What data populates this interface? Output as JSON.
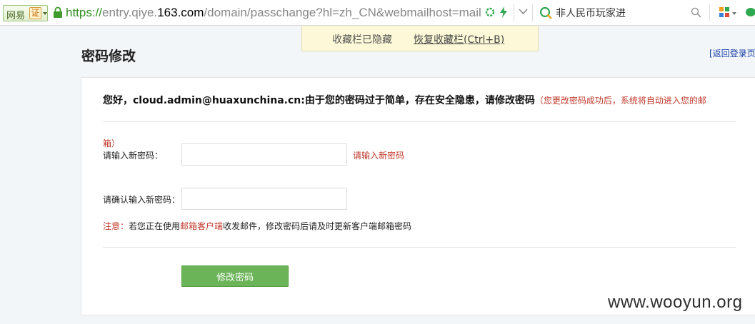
{
  "browser": {
    "site_name": "网易",
    "cert_label": "证",
    "url": {
      "scheme": "https://",
      "prefix": "entry.qiye.",
      "host": "163.com",
      "path": "/domain/passchange?hl=zh_CN&webmailhost=mail.h"
    },
    "search_value": "非人民币玩家进",
    "icons": {
      "lock": "lock-icon",
      "refresh": "refresh-icon",
      "speed": "lightning-icon",
      "dropdown": "chevron-down-icon",
      "engine": "search-engine-icon",
      "search": "search-icon",
      "apps": "apps-icon",
      "wechat": "wechat-icon"
    }
  },
  "fav_notice": {
    "message": "收藏栏已隐藏",
    "restore_label": "恢复收藏栏(Ctrl+B)"
  },
  "page": {
    "title": "密码修改",
    "back_link": "[返回登录页"
  },
  "notice": {
    "greeting": "您好，cloud.admin@huaxunchina.cn:由于您的密码过于简单，存在安全隐患，请修改密码",
    "note_first": "（您更改密码成功后，系统将自动进入您的邮",
    "note_rest": "箱）"
  },
  "form": {
    "new_password_label": "请输入新密码：",
    "new_password_value": "",
    "new_password_error": "请输入新密码",
    "confirm_password_label": "请确认输入新密码：",
    "confirm_password_value": "",
    "tip_prefix": "注意：",
    "tip_text_a": "若您正在使用",
    "tip_link": "邮箱客户端",
    "tip_text_b": "收发邮件，修改密码后请及时更新客户端邮箱密码",
    "submit_label": "修改密码"
  },
  "watermark": "www.wooyun.org",
  "colors": {
    "accent_green": "#6bb458",
    "error_red": "#c0392b",
    "link_blue": "#1a3fa8",
    "notice_bg": "#fdf9d8"
  }
}
